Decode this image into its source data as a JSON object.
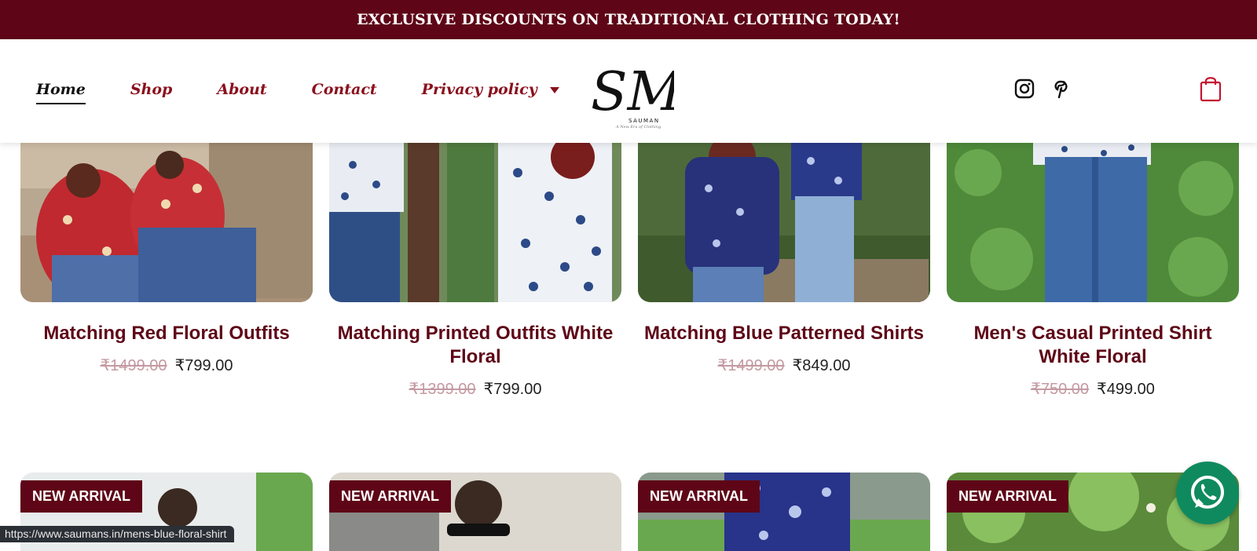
{
  "promo": {
    "text": "EXCLUSIVE DISCOUNTS ON TRADITIONAL CLOTHING TODAY!"
  },
  "nav": {
    "items": [
      {
        "label": "Home",
        "active": true
      },
      {
        "label": "Shop"
      },
      {
        "label": "About"
      },
      {
        "label": "Contact"
      },
      {
        "label": "Privacy policy",
        "has_dropdown": true
      }
    ]
  },
  "logo": {
    "monogram": "SM",
    "brand": "SAUMAN",
    "tagline": "A New Era of Clothing"
  },
  "header_icons": [
    "instagram-icon",
    "pinterest-icon",
    "shopping-bag-icon"
  ],
  "products": [
    {
      "title": "Matching Red Floral Outfits",
      "old_price": "₹1499.00",
      "price": "₹799.00"
    },
    {
      "title": "Matching Printed Outfits White Floral",
      "old_price": "₹1399.00",
      "price": "₹799.00"
    },
    {
      "title": "Matching Blue Patterned Shirts",
      "old_price": "₹1499.00",
      "price": "₹849.00"
    },
    {
      "title": "Men's Casual Printed Shirt White Floral",
      "old_price": "₹750.00",
      "price": "₹499.00"
    }
  ],
  "second_row": [
    {
      "badge": "NEW ARRIVAL"
    },
    {
      "badge": "NEW ARRIVAL"
    },
    {
      "badge": "NEW ARRIVAL"
    },
    {
      "badge": "NEW ARRIVAL"
    }
  ],
  "status_bar": {
    "url": "https://www.saumans.in/mens-blue-floral-shirt"
  },
  "colors": {
    "brand": "#5e0617",
    "nav_link": "#8a0f1c",
    "whatsapp": "#0f8a5f"
  }
}
